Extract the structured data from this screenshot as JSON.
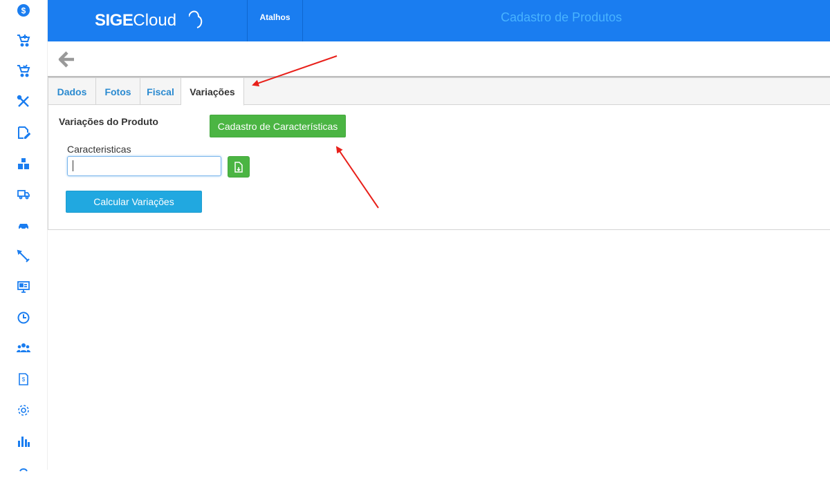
{
  "header": {
    "logo_brand": "SIGE",
    "logo_product": "Cloud",
    "shortcuts_label": "Atalhos",
    "page_title": "Cadastro de Produtos",
    "colors": {
      "bar": "#1a7df0",
      "title": "#48b3ff"
    }
  },
  "sidebar": {
    "icons": [
      "dollar-icon",
      "cart-add-icon",
      "cart-icon",
      "tools-icon",
      "edit-icon",
      "boxes-icon",
      "truck-icon",
      "car-icon",
      "pencil-icon",
      "monitor-icon",
      "clock-icon",
      "users-icon",
      "document-icon",
      "gear-icon",
      "bar-chart-icon",
      "more-icon"
    ],
    "color": "#1a7df0"
  },
  "toolbar": {
    "back_icon": "arrow-left-icon"
  },
  "tabs": [
    {
      "label": "Dados",
      "active": false
    },
    {
      "label": "Fotos",
      "active": false
    },
    {
      "label": "Fiscal",
      "active": false
    },
    {
      "label": "Variações",
      "active": true
    }
  ],
  "variations": {
    "section_title": "Variações do Produto",
    "characteristics_button": "Cadastro de Características",
    "field_label": "Caracteristicas",
    "field_value": "",
    "add_icon": "file-add-icon",
    "calculate_button": "Calcular Variações",
    "colors": {
      "green": "#4bb543",
      "blue": "#21a8e0"
    }
  },
  "annotations": {
    "arrow_color": "#e8201a"
  }
}
